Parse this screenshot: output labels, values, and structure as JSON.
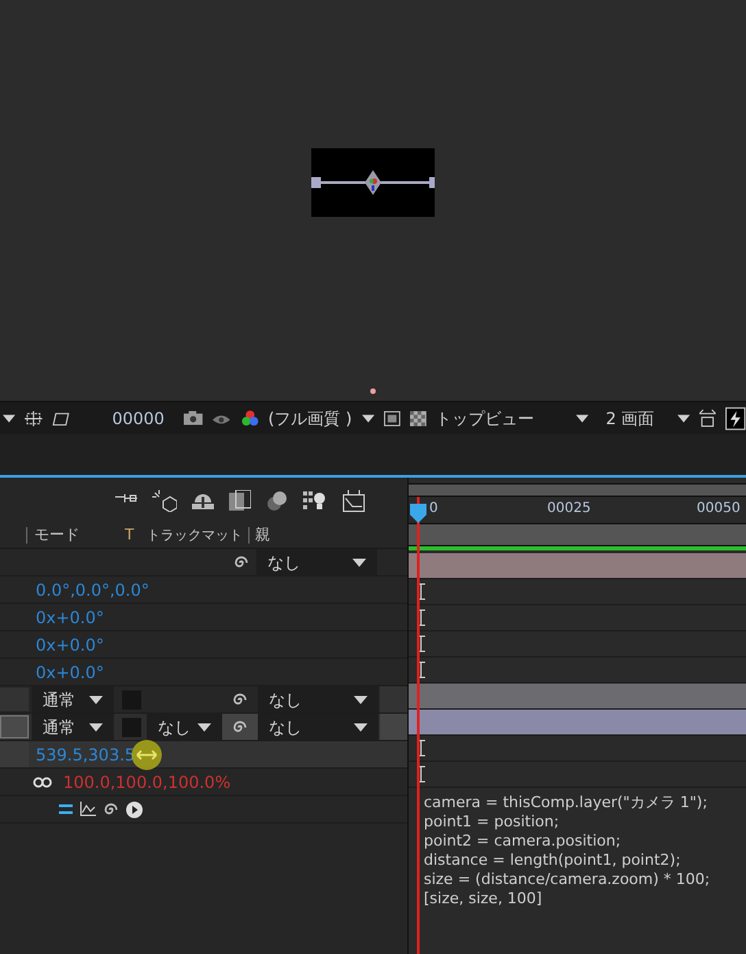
{
  "viewer_toolbar": {
    "timecode": "00000",
    "resolution": "(フル画質 )",
    "view": "トップビュー",
    "layout": "2 画面"
  },
  "columns": [
    "モード",
    "T",
    "トラックマット",
    "親"
  ],
  "ruler": {
    "labels": [
      "0",
      "00025",
      "00050"
    ]
  },
  "rows": [
    {
      "kind": "parent",
      "parent": "なし",
      "track": {
        "kind": "bar",
        "color": "#8f7a7e"
      }
    },
    {
      "kind": "value",
      "value": "0.0°,0.0°,0.0°",
      "track": {
        "kind": "keyframe"
      }
    },
    {
      "kind": "value",
      "value": "0x+0.0°",
      "track": {
        "kind": "keyframe"
      }
    },
    {
      "kind": "value",
      "value": "0x+0.0°",
      "track": {
        "kind": "keyframe"
      }
    },
    {
      "kind": "value",
      "value": "0x+0.0°",
      "track": {
        "kind": "keyframe"
      }
    },
    {
      "kind": "layer",
      "mode": "通常",
      "parent": "なし",
      "selected": false,
      "track": {
        "kind": "bar",
        "color": "#6c6c70"
      }
    },
    {
      "kind": "layer",
      "mode": "通常",
      "trackmatte": "なし",
      "parent": "なし",
      "selected": true,
      "track": {
        "kind": "bar",
        "color": "#8a8aa8"
      }
    },
    {
      "kind": "position",
      "value": "539.5,303.5",
      "track": {
        "kind": "keyframe"
      }
    },
    {
      "kind": "scale",
      "value": "100.0,100.0,100.0%",
      "track": {
        "kind": "keyframe"
      }
    },
    {
      "kind": "expression_tools"
    }
  ],
  "expression": [
    "camera = thisComp.layer(\"カメラ 1\");",
    "point1 = position;",
    "point2 = camera.position;",
    "distance = length(point1, point2);",
    "size = (distance/camera.zoom) * 100;",
    "[size, size, 100]"
  ]
}
